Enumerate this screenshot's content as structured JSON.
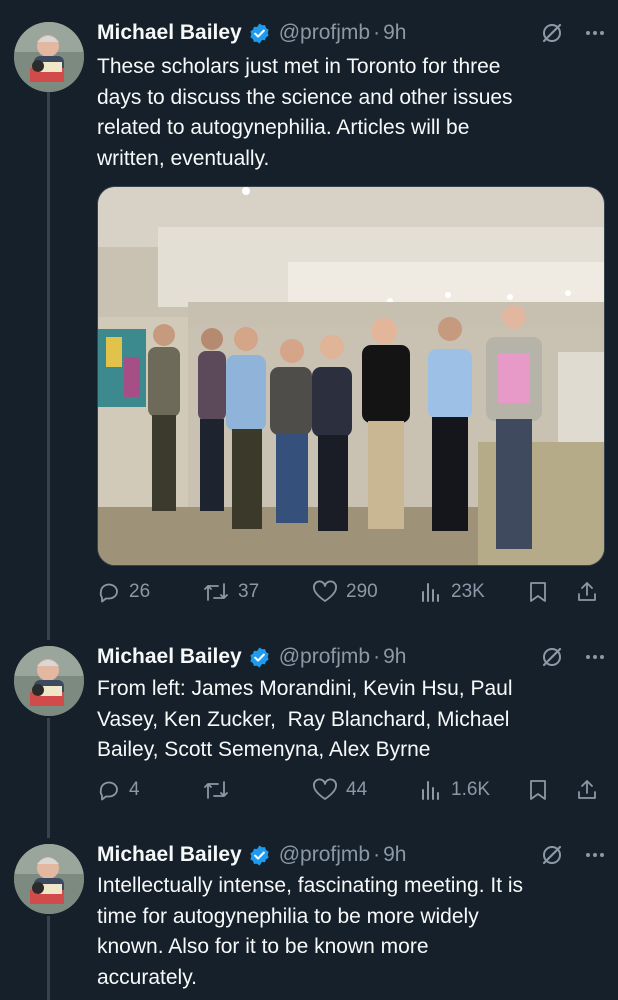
{
  "colors": {
    "background": "#15202b",
    "text": "#f7f9f9",
    "secondary": "#8b98a5",
    "verified": "#1d9bf0",
    "thread_line": "#38444d"
  },
  "tweets": [
    {
      "author": {
        "name": "Michael Bailey",
        "handle": "@profjmb",
        "verified": true
      },
      "time": "9h",
      "text_lines": [
        "These scholars just met in Toronto for three",
        "days to discuss the science and other issues",
        "related to autogynephilia. Articles will be",
        "written, eventually."
      ],
      "has_photo": true,
      "stats": {
        "replies": "26",
        "retweets": "37",
        "likes": "290",
        "views": "23K"
      }
    },
    {
      "author": {
        "name": "Michael Bailey",
        "handle": "@profjmb",
        "verified": true
      },
      "time": "9h",
      "text_lines": [
        "From left: James Morandini, Kevin Hsu, Paul",
        "Vasey, Ken Zucker,  Ray Blanchard, Michael",
        "Bailey, Scott Semenyna, Alex Byrne"
      ],
      "has_photo": false,
      "stats": {
        "replies": "4",
        "retweets": "",
        "likes": "44",
        "views": "1.6K"
      }
    },
    {
      "author": {
        "name": "Michael Bailey",
        "handle": "@profjmb",
        "verified": true
      },
      "time": "9h",
      "text_lines": [
        "Intellectually intense, fascinating meeting. It is",
        "time for autogynephilia to be more widely",
        "known. Also for it to be known more",
        "accurately."
      ],
      "has_photo": false,
      "stats": null
    }
  ],
  "icons": {
    "verified": "verified-badge-icon",
    "grok": "grok-icon",
    "more": "more-icon",
    "reply": "reply-icon",
    "retweet": "retweet-icon",
    "like": "heart-icon",
    "views": "views-icon",
    "bookmark": "bookmark-icon",
    "share": "share-icon"
  }
}
